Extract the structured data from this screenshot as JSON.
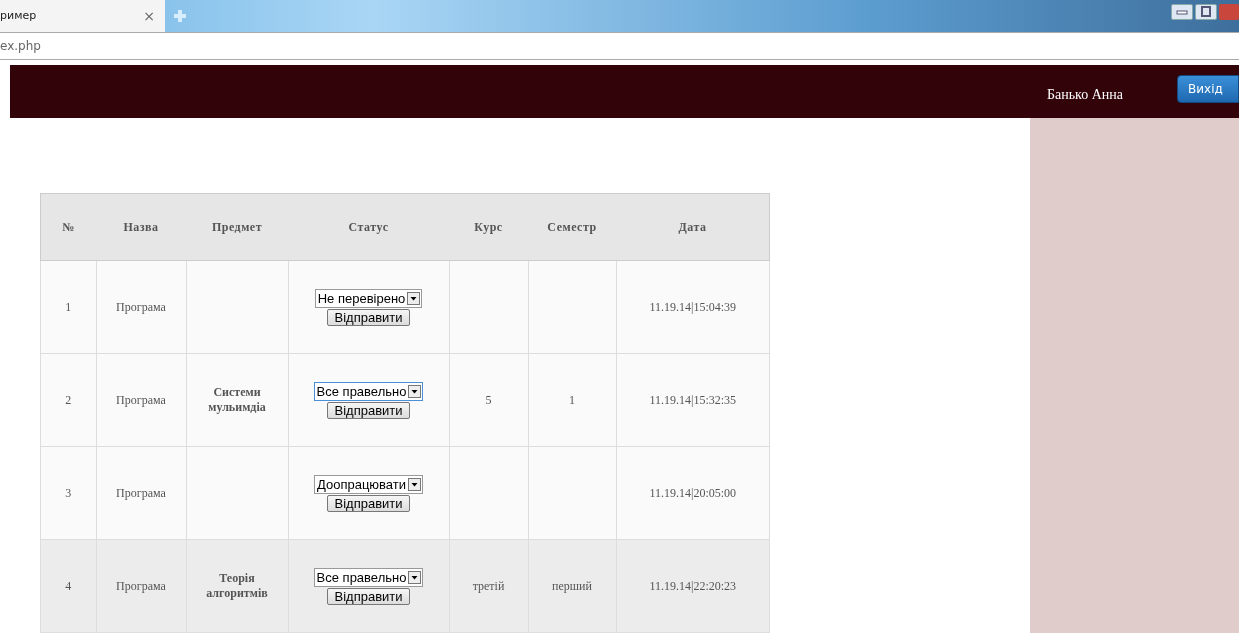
{
  "browser": {
    "tab_title": "ример",
    "tab_close": "×",
    "address": "ex.php"
  },
  "header": {
    "user_name": "Банько Анна",
    "logout_button": "Вихід"
  },
  "table": {
    "columns": [
      "№",
      "Назва",
      "Предмет",
      "Статус",
      "Курс",
      "Семестр",
      "Дата"
    ],
    "rows": [
      {
        "number": "1",
        "name": "Програма",
        "subject": "",
        "status": "Не перевірено",
        "status_focused": false,
        "submit": "Відправити",
        "course": "",
        "semester": "",
        "date": "11.19.14|15:04:39",
        "highlighted": false
      },
      {
        "number": "2",
        "name": "Програма",
        "subject": "Системи мульимдіа",
        "status": "Все правельно",
        "status_focused": true,
        "submit": "Відправити",
        "course": "5",
        "semester": "1",
        "date": "11.19.14|15:32:35",
        "highlighted": false
      },
      {
        "number": "3",
        "name": "Програма",
        "subject": "",
        "status": "Доопрацювати",
        "status_focused": false,
        "submit": "Відправити",
        "course": "",
        "semester": "",
        "date": "11.19.14|20:05:00",
        "highlighted": false
      },
      {
        "number": "4",
        "name": "Програма",
        "subject": "Теорія алгоритмів",
        "status": "Все правельно",
        "status_focused": false,
        "submit": "Відправити",
        "course": "третій",
        "semester": "перший",
        "date": "11.19.14|22:20:23",
        "highlighted": true
      }
    ]
  }
}
